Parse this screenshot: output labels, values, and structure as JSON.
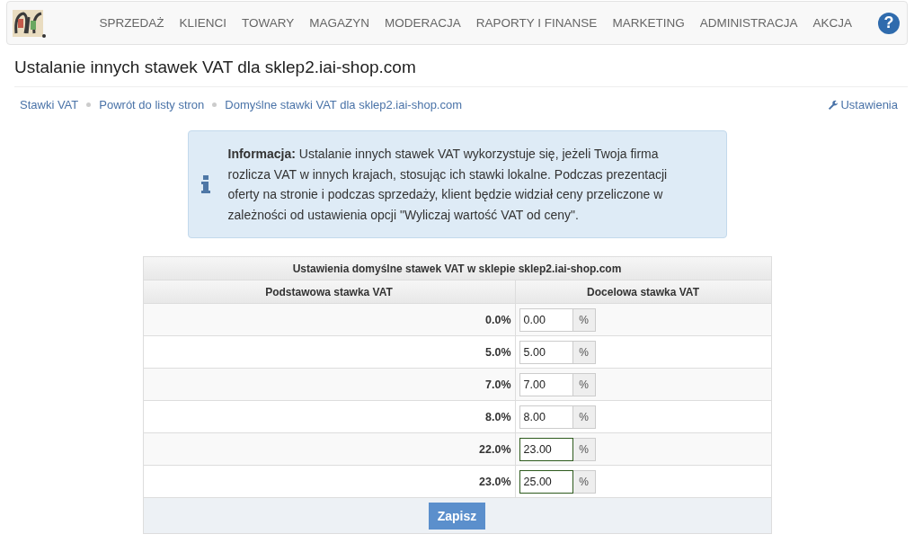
{
  "nav": {
    "items": [
      "SPRZEDAŻ",
      "KLIENCI",
      "TOWARY",
      "MAGAZYN",
      "MODERACJA",
      "RAPORTY I FINANSE",
      "MARKETING",
      "ADMINISTRACJA",
      "AKCJA"
    ],
    "help": "?"
  },
  "title": "Ustalanie innych stawek VAT dla sklep2.iai-shop.com",
  "breadcrumbs": [
    "Stawki VAT",
    "Powrót do listy stron",
    "Domyślne stawki VAT dla sklep2.iai-shop.com"
  ],
  "settings_link": "Ustawienia",
  "info": "**Informacja:** Ustalanie innych stawek VAT wykorzystuje się, jeżeli Twoja firma rozlicza VAT w innych krajach, stosując ich stawki lokalne. Podczas prezentacji oferty na stronie i podczas sprzedaży, klient będzie widział ceny przeliczone w zależności od ustawienia opcji \"Wyliczaj wartość VAT od ceny\".",
  "table": {
    "caption": "Ustawienia domyślne stawek VAT w sklepie sklep2.iai-shop.com",
    "columns": [
      "Podstawowa stawka VAT",
      "Docelowa stawka VAT"
    ],
    "rows": [
      {
        "base": "0.0%",
        "value": "0.00",
        "unit": "%",
        "changed": false
      },
      {
        "base": "5.0%",
        "value": "5.00",
        "unit": "%",
        "changed": false
      },
      {
        "base": "7.0%",
        "value": "7.00",
        "unit": "%",
        "changed": false
      },
      {
        "base": "8.0%",
        "value": "8.00",
        "unit": "%",
        "changed": false
      },
      {
        "base": "22.0%",
        "value": "23.00",
        "unit": "%",
        "changed": true
      },
      {
        "base": "23.0%",
        "value": "25.00",
        "unit": "%",
        "changed": true
      }
    ],
    "save_button": "Zapisz"
  }
}
